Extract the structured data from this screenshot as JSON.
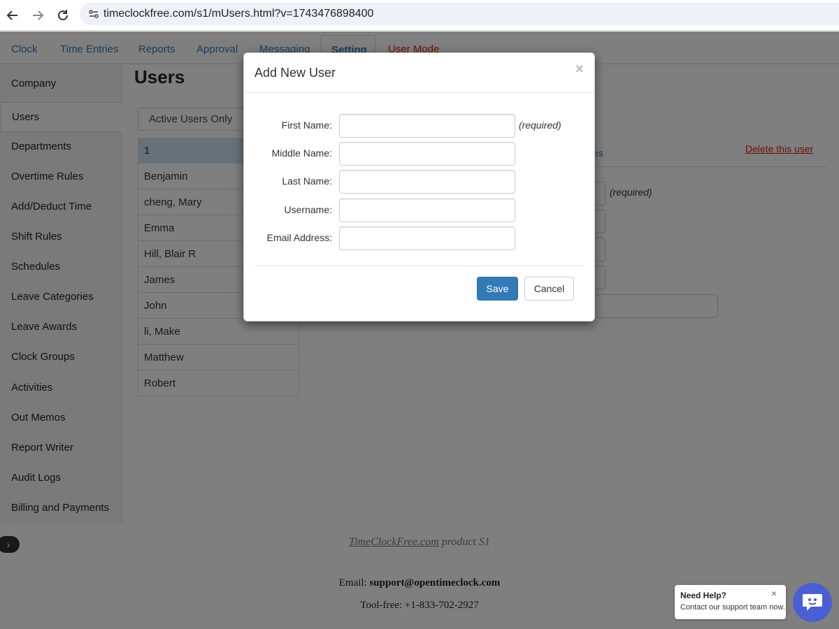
{
  "browser": {
    "url": "timeclockfree.com/s1/mUsers.html?v=1743476898400"
  },
  "topnav": {
    "items": [
      "Clock",
      "Time Entries",
      "Reports",
      "Approval",
      "Messaging",
      "Setting",
      "User Mode"
    ]
  },
  "sidebar": {
    "items": [
      "Company",
      "Users",
      "Departments",
      "Overtime Rules",
      "Add/Deduct Time",
      "Shift Rules",
      "Schedules",
      "Leave Categories",
      "Leave Awards",
      "Clock Groups",
      "Activities",
      "Out Memos",
      "Report Writer",
      "Audit Logs",
      "Billing and Payments"
    ]
  },
  "main": {
    "title": "Users",
    "filter": "Active Users Only",
    "users": [
      "1",
      "Benjamin",
      "cheng, Mary",
      "Emma",
      "Hill, Blair R",
      "James",
      "John",
      "li, Make",
      "Matthew",
      "Robert"
    ],
    "notes_partial": "es",
    "delete_link": "Delete this user",
    "required": "(required)"
  },
  "modal": {
    "title": "Add New User",
    "close": "×",
    "fields": {
      "first_name": "First Name:",
      "middle_name": "Middle Name:",
      "last_name": "Last Name:",
      "username": "Username:",
      "email": "Email Address:"
    },
    "required": "(required)",
    "save": "Save",
    "cancel": "Cancel"
  },
  "footer": {
    "product_link": "TimeClockFree.com",
    "product_rest": " product S1",
    "email_label": "Email: ",
    "email": "support@opentimeclock.com",
    "phone": "Tool-free: +1-833-702-2927"
  },
  "help": {
    "title": "Need Help?",
    "subtitle": "Contact our support team now.",
    "close": "×"
  },
  "colors": {
    "link": "#337ab7",
    "danger": "#d9230f",
    "primary": "#337ab7",
    "help_bubble": "#4a5fd3"
  }
}
